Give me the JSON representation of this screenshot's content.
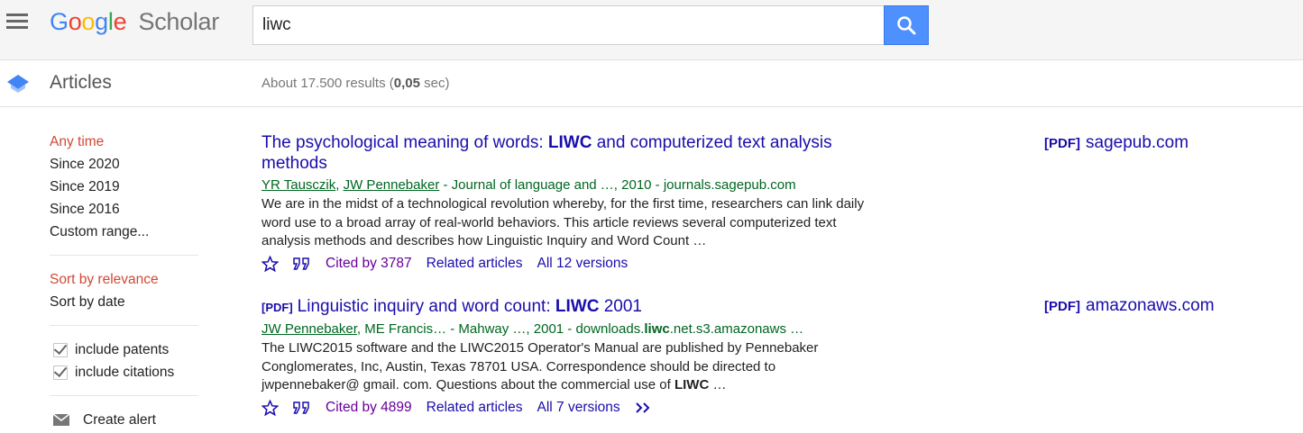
{
  "header": {
    "logo": {
      "google": [
        "G",
        "o",
        "o",
        "g",
        "l",
        "e"
      ],
      "google_colors": [
        "#4285f4",
        "#ea4335",
        "#fbbc05",
        "#4285f4",
        "#34a853",
        "#ea4335"
      ],
      "product": "Scholar"
    },
    "search": {
      "value": "liwc"
    },
    "icons": {
      "menu": "hamburger-menu-icon",
      "search": "search-icon"
    },
    "accent_color": "#4d90fe"
  },
  "subbar": {
    "section": "Articles",
    "results_prefix": "About 17.500 results (",
    "results_time": "0,05",
    "results_suffix": " sec)"
  },
  "sidebar": {
    "time_filters": [
      "Any time",
      "Since 2020",
      "Since 2019",
      "Since 2016",
      "Custom range..."
    ],
    "sort_options": [
      "Sort by relevance",
      "Sort by date"
    ],
    "checkboxes": [
      "include patents",
      "include citations"
    ],
    "create_alert": "Create alert",
    "active_color": "#d14836"
  },
  "results": [
    {
      "title_before": "The psychological meaning of words: ",
      "title_bold": "LIWC",
      "title_after": " and computerized text analysis methods",
      "authors": [
        "YR Tausczik",
        "JW Pennebaker"
      ],
      "meta_rest": " - Journal of language and …, 2010 - journals.sagepub.com",
      "snippet": "We are in the midst of a technological revolution whereby, for the first time, researchers can link daily word use to a broad array of real-world behaviors. This article reviews several computerized text analysis methods and describes how Linguistic Inquiry and Word Count …",
      "cited_by": "Cited by 3787",
      "related": "Related articles",
      "versions": "All 12 versions",
      "side_tag": "[PDF]",
      "side_domain": "sagepub.com"
    },
    {
      "pdf_tag": "[PDF]",
      "title_before": "Linguistic inquiry and word count: ",
      "title_bold": "LIWC",
      "title_after": " 2001",
      "authors": [
        "JW Pennebaker"
      ],
      "meta_after_author": ", ME Francis… - Mahway …, 2001 - downloads.",
      "meta_bold": "liwc",
      "meta_end": ".net.s3.amazonaws …",
      "snippet_before": "The LIWC2015 software and the LIWC2015 Operator's Manual are published by Pennebaker Conglomerates, Inc, Austin, Texas 78701 USA. Correspondence should be directed to jwpennebaker@ gmail. com. Questions about the commercial use of ",
      "snippet_bold": "LIWC",
      "snippet_end": "  …",
      "cited_by": "Cited by 4899",
      "related": "Related articles",
      "versions": "All 7 versions",
      "side_tag": "[PDF]",
      "side_domain": "amazonaws.com"
    }
  ],
  "link_color": "#1a0dab",
  "cited_color": "#660099",
  "meta_color": "#006621"
}
